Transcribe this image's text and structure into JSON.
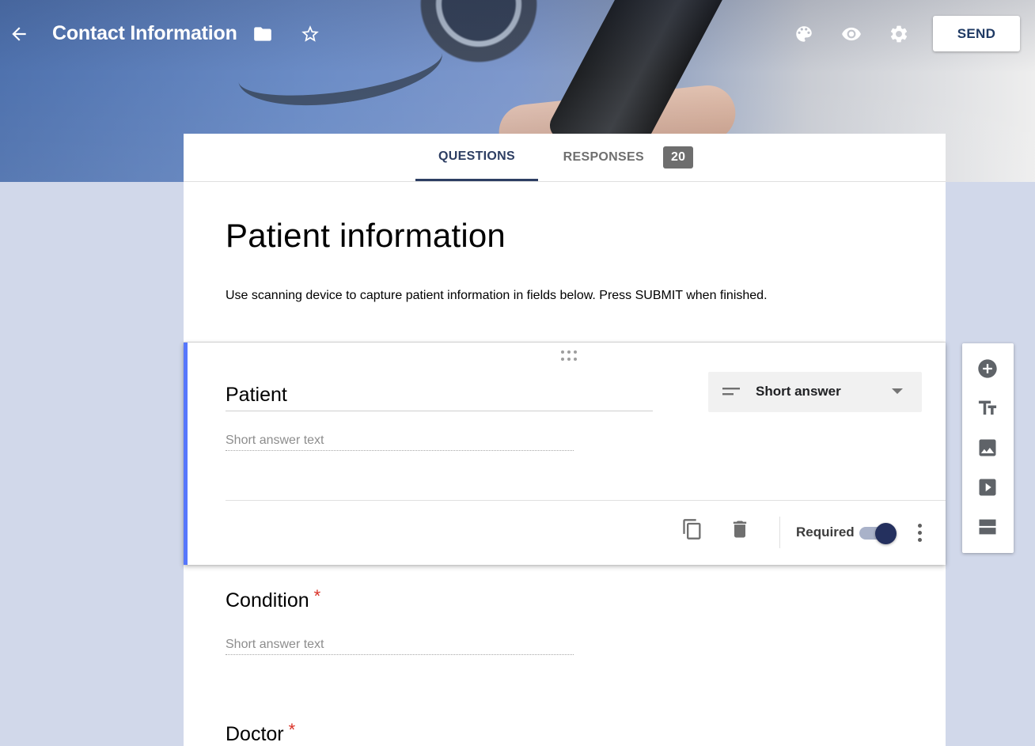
{
  "header": {
    "title": "Contact Information",
    "send_label": "SEND",
    "icons": [
      "arrow-back-icon",
      "folder-icon",
      "star-outline-icon",
      "palette-icon",
      "eye-icon",
      "gear-icon"
    ]
  },
  "tabs": [
    {
      "label": "QUESTIONS",
      "active": true
    },
    {
      "label": "RESPONSES",
      "active": false,
      "count": "20"
    }
  ],
  "form": {
    "title": "Patient information",
    "description": "Use scanning device to capture patient information in fields below. Press SUBMIT when finished."
  },
  "questions": [
    {
      "title": "Patient",
      "placeholder": "Short answer text",
      "type": "Short answer",
      "required_label": "Required",
      "required": true,
      "active": true
    },
    {
      "title": "Condition",
      "placeholder": "Short answer text",
      "required_mark": "*"
    },
    {
      "title": "Doctor",
      "required_mark": "*"
    }
  ],
  "side_tools": [
    "add-question-icon",
    "add-title-icon",
    "add-image-icon",
    "add-video-icon",
    "add-section-icon"
  ],
  "colors": {
    "accent": "#2d3e63",
    "active_border": "#5677fc",
    "required": "#d93025",
    "background": "#d1d8ea"
  }
}
